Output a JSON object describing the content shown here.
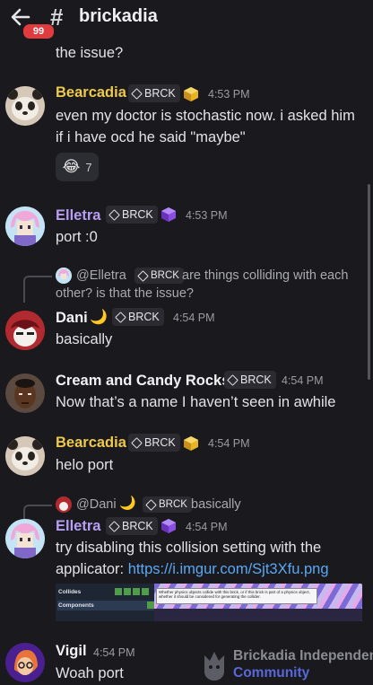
{
  "header": {
    "unread_count": "99",
    "hash": "#",
    "channel_name": "brickadia"
  },
  "continuation_text": "the issue?",
  "messages": [
    {
      "author": "Bearcadia",
      "tag": "BRCK",
      "time": "4:53 PM",
      "lines": [
        "even my doctor is stochastic now. i asked him",
        "if i have ocd he said \"maybe\""
      ],
      "reaction": {
        "emoji": "😂",
        "count": "7"
      }
    },
    {
      "author": "Elletra",
      "tag": "BRCK",
      "time": "4:53 PM",
      "lines": [
        "port :0"
      ]
    },
    {
      "reply": {
        "mention": "@Elletra",
        "tag": "BRCK",
        "lines": [
          "are things colliding with each",
          "other? is that the issue?"
        ]
      },
      "author": "Dani",
      "emoji": "🌙",
      "tag": "BRCK",
      "time": "4:54 PM",
      "lines": [
        "basically"
      ]
    },
    {
      "author": "Cream and Candy Rocks",
      "tag": "BRCK",
      "time": "4:54 PM",
      "lines": [
        "Now that’s a name I haven’t seen in awhile"
      ]
    },
    {
      "author": "Bearcadia",
      "tag": "BRCK",
      "time": "4:54 PM",
      "lines": [
        "helo port"
      ]
    },
    {
      "reply": {
        "mention": "@Dani",
        "emoji": "🌙",
        "tag": "BRCK",
        "text": "basically"
      },
      "author": "Elletra",
      "tag": "BRCK",
      "time": "4:54 PM",
      "lines": [
        "try disabling this collision setting with the",
        "applicator: "
      ],
      "link": "https://i.imgur.com/Sjt3Xfu.png",
      "embed": {
        "row1": "Collides",
        "row2": "Components",
        "tooltip": "Whether physics objects collide with this brick, or if this brick is part of a physics object, whether it should be considered for generating the collider."
      }
    },
    {
      "author": "Vigil",
      "time": "4:54 PM",
      "lines": [
        "Woah port"
      ]
    }
  ],
  "watermark": {
    "title": "Brickadia Independent",
    "subtitle": "Community"
  },
  "colors": {
    "background": "#1a1a1e",
    "gold_name": "#eec94a",
    "purple_name": "#b79df3",
    "link": "#5aa8f5",
    "badge": "#e03b3e"
  }
}
